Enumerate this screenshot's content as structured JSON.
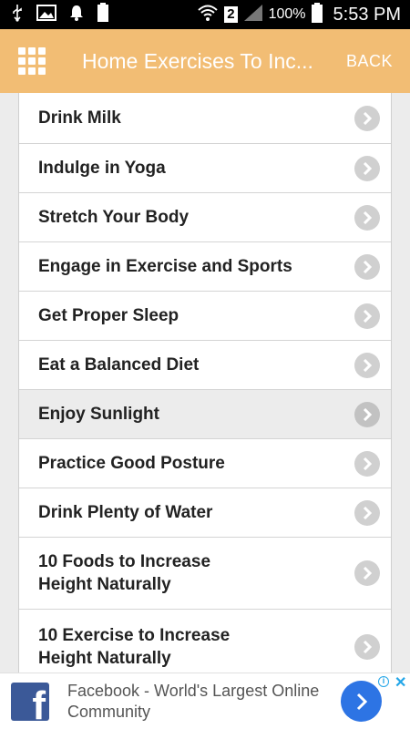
{
  "status_bar": {
    "sim_badge": "2",
    "battery_percent": "100%",
    "battery_label": "100",
    "time": "5:53 PM",
    "icons": [
      "usb-icon",
      "image-icon",
      "notification-bell-icon",
      "battery-small-icon",
      "wifi-icon",
      "signal-icon",
      "battery-icon"
    ]
  },
  "app_bar": {
    "menu_icon": "grid-menu-icon",
    "title": "Home Exercises To Inc...",
    "back_label": "BACK",
    "color": "#f2bd74"
  },
  "list": {
    "items": [
      {
        "label": "Drink Milk"
      },
      {
        "label": "Indulge in Yoga"
      },
      {
        "label": "Stretch Your Body"
      },
      {
        "label": "Engage in Exercise and Sports"
      },
      {
        "label": "Get Proper Sleep"
      },
      {
        "label": "Eat a Balanced Diet"
      },
      {
        "label": "Enjoy Sunlight",
        "active": true
      },
      {
        "label": "Practice Good Posture"
      },
      {
        "label": "Drink Plenty of Water"
      },
      {
        "label": "10 Foods to Increase Height Naturally"
      },
      {
        "label": "10 Exercise to Increase Height Naturally"
      }
    ],
    "item_icon": "chevron-right-icon"
  },
  "ad": {
    "logo_letter": "f",
    "text": "Facebook - World's Largest Online Community",
    "info_symbol": "i",
    "close_symbol": "✕",
    "brand_color": "#3b5998",
    "button_color": "#2d74e4"
  }
}
